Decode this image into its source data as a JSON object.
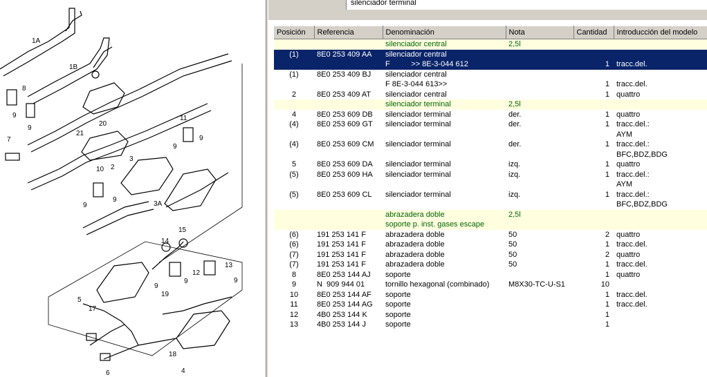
{
  "diagram": {
    "labels": [
      "1A",
      "1B",
      "8",
      "9",
      "9",
      "7",
      "21",
      "20",
      "10",
      "9",
      "9",
      "3",
      "3A",
      "2",
      "11",
      "9",
      "9",
      "14",
      "15",
      "13",
      "12",
      "9",
      "9",
      "9",
      "19",
      "5",
      "17",
      "18",
      "6",
      "4"
    ]
  },
  "top_text": "silenciador terminal",
  "table": {
    "headers": [
      "Posición",
      "Referencia",
      "Denominación",
      "Nota",
      "Cantidad",
      "Introducción del modelo"
    ],
    "rows": [
      {
        "pos": "",
        "ref": "",
        "den": "silenciador central",
        "nota": "2,5l",
        "qty": "",
        "intro": "",
        "group": true
      },
      {
        "pos": "(1)",
        "ref": "8E0 253 409 AA",
        "den": "silenciador central\nF          >> 8E-3-044 612",
        "nota": "",
        "qty": "\n1",
        "intro": "\ntracc.del.",
        "selected": true
      },
      {
        "pos": "(1)",
        "ref": "8E0 253 409 BJ",
        "den": "silenciador central\nF 8E-3-044 613>>",
        "nota": "",
        "qty": "\n1",
        "intro": "\ntracc.del."
      },
      {
        "pos": "2",
        "ref": "8E0 253 409 AT",
        "den": "silenciador central",
        "nota": "",
        "qty": "1",
        "intro": "quattro"
      },
      {
        "pos": "",
        "ref": "",
        "den": "",
        "nota": "",
        "qty": "",
        "intro": ""
      },
      {
        "pos": "",
        "ref": "",
        "den": "silenciador terminal",
        "nota": "2,5l",
        "qty": "",
        "intro": "",
        "group": true
      },
      {
        "pos": "4",
        "ref": "8E0 253 609 DB",
        "den": "silenciador terminal",
        "nota": "der.",
        "qty": "1",
        "intro": "quattro"
      },
      {
        "pos": "(4)",
        "ref": "8E0 253 609 GT",
        "den": "silenciador terminal",
        "nota": "der.",
        "qty": "1",
        "intro": "tracc.del.:\nAYM"
      },
      {
        "pos": "(4)",
        "ref": "8E0 253 609 CM",
        "den": "silenciador terminal",
        "nota": "der.",
        "qty": "1",
        "intro": "tracc.del.:\nBFC,BDZ,BDG"
      },
      {
        "pos": "5",
        "ref": "8E0 253 609 DA",
        "den": "silenciador terminal",
        "nota": "izq.",
        "qty": "1",
        "intro": "quattro"
      },
      {
        "pos": "(5)",
        "ref": "8E0 253 609 HA",
        "den": "silenciador terminal",
        "nota": "izq.",
        "qty": "1",
        "intro": "tracc.del.:\nAYM"
      },
      {
        "pos": "(5)",
        "ref": "8E0 253 609 CL",
        "den": "silenciador terminal",
        "nota": "izq.",
        "qty": "1",
        "intro": "tracc.del.:\nBFC,BDZ,BDG"
      },
      {
        "pos": "",
        "ref": "",
        "den": "",
        "nota": "",
        "qty": "",
        "intro": ""
      },
      {
        "pos": "",
        "ref": "",
        "den": "abrazadera doble\nsoporte p. inst. gases escape",
        "nota": "2,5l",
        "qty": "",
        "intro": "",
        "group": true
      },
      {
        "pos": "(6)",
        "ref": "191 253 141 F",
        "den": "abrazadera doble",
        "nota": "50",
        "qty": "2",
        "intro": "quattro"
      },
      {
        "pos": "(6)",
        "ref": "191 253 141 F",
        "den": "abrazadera doble",
        "nota": "50",
        "qty": "1",
        "intro": "tracc.del."
      },
      {
        "pos": "(7)",
        "ref": "191 253 141 F",
        "den": "abrazadera doble",
        "nota": "50",
        "qty": "2",
        "intro": "quattro"
      },
      {
        "pos": "(7)",
        "ref": "191 253 141 F",
        "den": "abrazadera doble",
        "nota": "50",
        "qty": "1",
        "intro": "tracc.del."
      },
      {
        "pos": "8",
        "ref": "8E0 253 144 AJ",
        "den": "soporte",
        "nota": "",
        "qty": "1",
        "intro": "quattro"
      },
      {
        "pos": "9",
        "ref": "N  909 944 01",
        "den": "tornillo hexagonal (combinado)",
        "nota": "M8X30-TC-U-S1",
        "qty": "10",
        "intro": ""
      },
      {
        "pos": "10",
        "ref": "8E0 253 144 AF",
        "den": "soporte",
        "nota": "",
        "qty": "1",
        "intro": "tracc.del."
      },
      {
        "pos": "11",
        "ref": "8E0 253 144 AG",
        "den": "soporte",
        "nota": "",
        "qty": "1",
        "intro": "tracc.del."
      },
      {
        "pos": "12",
        "ref": "4B0 253 144 K",
        "den": "soporte",
        "nota": "",
        "qty": "1",
        "intro": ""
      },
      {
        "pos": "13",
        "ref": "4B0 253 144 J",
        "den": "soporte",
        "nota": "",
        "qty": "1",
        "intro": ""
      }
    ]
  },
  "colors": {
    "selection": "#0a246a",
    "group_bg": "#ffffe0",
    "group_text": "#006400",
    "chrome": "#d4d0c8"
  }
}
